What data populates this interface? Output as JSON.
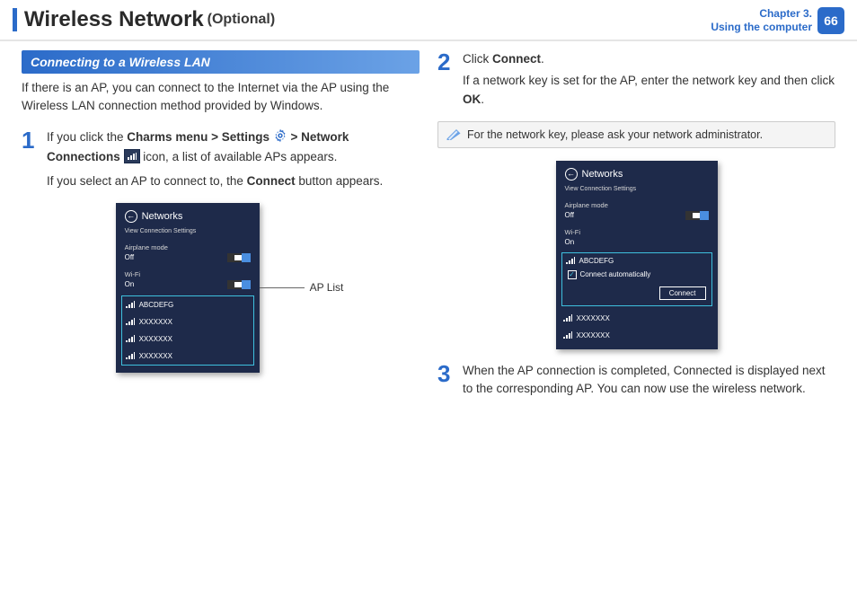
{
  "header": {
    "title": "Wireless Network",
    "suffix": "(Optional)",
    "chapter_line1": "Chapter 3.",
    "chapter_line2": "Using the computer",
    "page_number": "66"
  },
  "section_heading": "Connecting to a Wireless LAN",
  "intro": "If there is an AP, you can connect to the Internet via the AP using the Wireless LAN connection method provided by Windows.",
  "steps": {
    "s1": {
      "num": "1",
      "p1_a": "If you click the ",
      "p1_b": "Charms menu > Settings",
      "p1_c": " > ",
      "p1_d": "Network Connections",
      "p1_e": " icon, a list of available APs appears.",
      "p2_a": "If you select an AP to connect to, the ",
      "p2_b": "Connect",
      "p2_c": " button appears."
    },
    "s2": {
      "num": "2",
      "p1_a": "Click ",
      "p1_b": "Connect",
      "p1_c": ".",
      "p2_a": "If a network key is set for the AP, enter the network key and then click ",
      "p2_b": "OK",
      "p2_c": "."
    },
    "s3": {
      "num": "3",
      "p1": "When the AP connection is completed, Connected is displayed next to the corresponding AP. You can now use the wireless network."
    }
  },
  "note": "For the network key, please ask your network administrator.",
  "callout_ap_list": "AP List",
  "panel": {
    "title": "Networks",
    "view_settings": "View Connection Settings",
    "airplane_label": "Airplane mode",
    "airplane_state": "Off",
    "wifi_label": "Wi-Fi",
    "wifi_state": "On",
    "aps": [
      "ABCDEFG",
      "XXXXXXX",
      "XXXXXXX",
      "XXXXXXX"
    ],
    "connect_auto": "Connect automatically",
    "connect_btn": "Connect"
  }
}
